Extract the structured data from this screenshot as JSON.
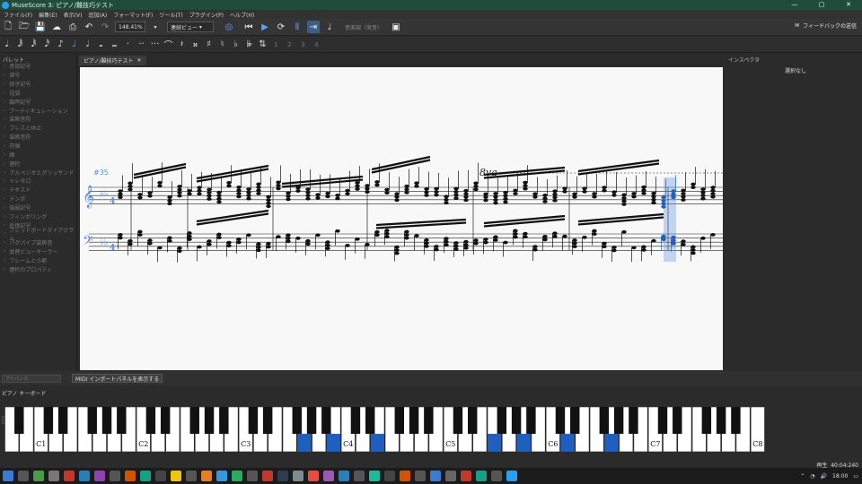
{
  "window": {
    "title": "MuseScore 3: ピアノ/難技巧テスト"
  },
  "menu": [
    "ファイル(F)",
    "編集(E)",
    "表示(V)",
    "追加(A)",
    "フォーマット(F)",
    "ツール(T)",
    "プラグイン(P)",
    "ヘルプ(H)"
  ],
  "toolbar": {
    "zoom": "148.41%",
    "view_mode": "連続ビュー",
    "concert_pitch": "音楽調（実音）",
    "feedback": "フィードバックの送信"
  },
  "notebar": {
    "voices": [
      "1",
      "2",
      "3",
      "4"
    ]
  },
  "palette": {
    "title": "パレット",
    "items": [
      "音部記号",
      "調号",
      "拍子記号",
      "括弧",
      "臨時記号",
      "アーティキュレーション",
      "装飾音符",
      "ブレスと休止",
      "装飾音符",
      "符頭",
      "線",
      "連桁",
      "アルペジオとグリッサンド",
      "トレモロ",
      "テキスト",
      "テンポ",
      "強弱記号",
      "フィンガリング",
      "反復記号",
      "フレットボードダイアグラム",
      "バグパイプ装飾音",
      "並替ビューキーラー",
      "フレームと小節",
      "連桁のプロパティ"
    ],
    "search_placeholder": "検索"
  },
  "tab": {
    "label": "ピアノ/難技巧テスト"
  },
  "score": {
    "measure_number": "#35",
    "ottava": "8va"
  },
  "inspector": {
    "title": "インスペクタ",
    "empty": "選択なし"
  },
  "midbar": {
    "selection_mode": "アドバンス",
    "midi_button": "MIDI インポートパネルを表示する"
  },
  "keyboard": {
    "title": "ピアノ キーボード",
    "octave_labels": [
      "C1",
      "C2",
      "C3",
      "C4",
      "C5",
      "C6",
      "C7",
      "C8"
    ]
  },
  "status": {
    "playback": "再生",
    "time": "40:04:240"
  },
  "taskbar": {
    "clock": "18:00"
  },
  "colors": {
    "accent": "#1f5fbf",
    "highlight": "#5b8fe0",
    "titlebar": "#1e4d3a"
  }
}
